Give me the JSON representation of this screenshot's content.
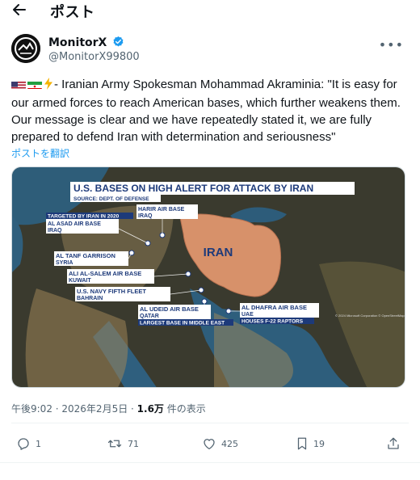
{
  "header": {
    "title": "ポスト",
    "back_icon": "arrow-left-icon"
  },
  "author": {
    "name": "MonitorX",
    "handle": "@MonitorX99800",
    "verified_color": "#1d9bf0",
    "avatar_icon": "monitor-x-logo"
  },
  "tweet": {
    "emoji_prefix": [
      "us-flag",
      "iran-flag",
      "lightning-icon"
    ],
    "text": "- Iranian Army Spokesman Mohammad Akraminia: \"It is easy for our armed forces to reach American bases, which further weakens them. Our message is clear and we have repeatedly stated it, we are fully prepared to defend Iran with determination and seriousness\"",
    "translate_label": "ポストを翻訳"
  },
  "media": {
    "title": "U.S. BASES ON HIGH ALERT FOR ATTACK BY IRAN",
    "source": "SOURCE: DEPT. OF DEFENSE",
    "country_label": "IRAN",
    "labels": [
      {
        "lines": [
          "TARGETED BY IRAN IN 2020",
          "AL ASAD AIR BASE",
          "IRAQ"
        ]
      },
      {
        "lines": [
          "HARIR AIR BASE",
          "IRAQ"
        ]
      },
      {
        "lines": [
          "AL TANF GARRISON",
          "SYRIA"
        ]
      },
      {
        "lines": [
          "ALI AL-SALEM AIR BASE",
          "KUWAIT"
        ]
      },
      {
        "lines": [
          "U.S. NAVY FIFTH FLEET",
          "BAHRAIN"
        ]
      },
      {
        "lines": [
          "AL UDEID AIR BASE",
          "QATAR",
          "LARGEST BASE IN MIDDLE EAST"
        ]
      },
      {
        "lines": [
          "AL DHAFRA AIR BASE",
          "UAE",
          "HOUSES F-22 RAPTORS"
        ]
      }
    ],
    "attribution": "© 2024 Microsoft Corporation\n© OpenStreetMap"
  },
  "meta": {
    "time": "午後9:02 · 2026年2月5日 · ",
    "views": "1.6万",
    "views_suffix": " 件の表示"
  },
  "actions": {
    "reply_count": "1",
    "repost_count": "71",
    "like_count": "425",
    "bookmark_count": "19"
  }
}
